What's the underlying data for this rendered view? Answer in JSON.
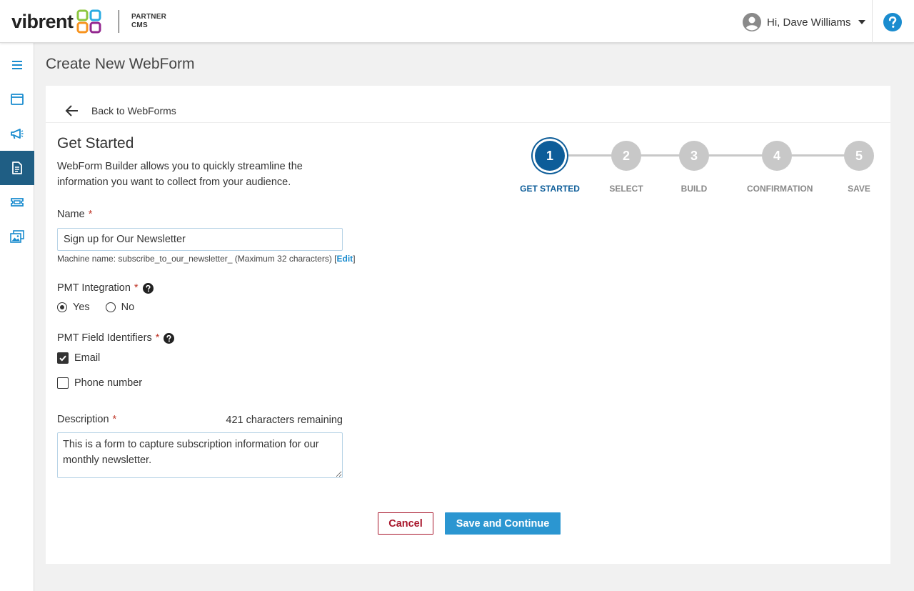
{
  "app": {
    "logo_text": "vibrent",
    "logo_sub_1": "PARTNER",
    "logo_sub_2": "CMS"
  },
  "header": {
    "user_greeting": "Hi, Dave Williams"
  },
  "sidebar": {
    "items": [
      {
        "icon": "menu-icon"
      },
      {
        "icon": "browser-window-icon"
      },
      {
        "icon": "megaphone-icon"
      },
      {
        "icon": "document-icon",
        "active": true
      },
      {
        "icon": "ticket-icon"
      },
      {
        "icon": "images-icon"
      }
    ]
  },
  "page": {
    "title": "Create New WebForm"
  },
  "back": {
    "label": "Back to WebForms"
  },
  "form": {
    "section_title": "Get Started",
    "intro": "WebForm Builder allows you to quickly streamline the information you want to collect from your audience.",
    "required_mark": "*",
    "name_label": "Name",
    "name_value": "Sign up for Our Newsletter",
    "machine_prefix": "Machine name: subscribe_to_our_newsletter_ (Maximum 32 characters) [",
    "machine_edit": "Edit",
    "machine_suffix": "]",
    "pmt_label": "PMT Integration",
    "pmt_yes": "Yes",
    "pmt_no": "No",
    "pmt_selected": "Yes",
    "fields_label": "PMT Field Identifiers",
    "field_email": "Email",
    "field_email_checked": true,
    "field_phone": "Phone number",
    "field_phone_checked": false,
    "desc_label": "Description",
    "desc_remaining": "421 characters remaining",
    "desc_value": "This is a form to capture subscription information for our monthly newsletter.",
    "cancel_label": "Cancel",
    "save_label": "Save and Continue"
  },
  "stepper": {
    "steps": [
      {
        "num": "1",
        "label": "GET STARTED",
        "active": true
      },
      {
        "num": "2",
        "label": "SELECT"
      },
      {
        "num": "3",
        "label": "BUILD"
      },
      {
        "num": "4",
        "label": "CONFIRMATION"
      },
      {
        "num": "5",
        "label": "SAVE"
      }
    ]
  },
  "colors": {
    "primary": "#2b96d1",
    "active_step": "#0d5d99",
    "sidebar_active": "#1f5e84",
    "danger": "#a8162b"
  }
}
